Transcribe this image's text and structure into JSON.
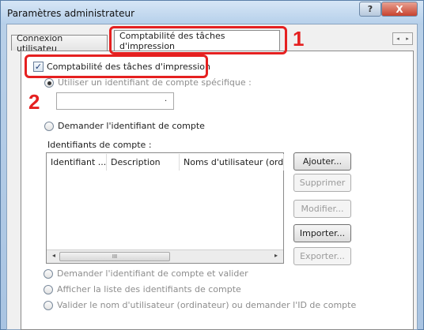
{
  "window": {
    "title": "Paramètres administrateur",
    "help_label": "?",
    "close_label": "X"
  },
  "tabs": [
    {
      "label": "Connexion utilisateu"
    },
    {
      "label": "Comptabilité des tâches d'impression"
    }
  ],
  "tab_scroll": {
    "left": "◂",
    "right": "▸"
  },
  "callouts": {
    "one": "1",
    "two": "2"
  },
  "accounting_checkbox": {
    "label": "Comptabilité des tâches d'impression",
    "checked": true
  },
  "option_specific_id": {
    "label": "Utiliser un identifiant de compte spécifique :"
  },
  "account_id_field": {
    "value": "."
  },
  "option_ask_id": {
    "label": "Demander l'identifiant de compte"
  },
  "account_ids": {
    "label": "Identifiants de compte :",
    "columns": [
      "Identifiant ...",
      "Description",
      "Noms d'utilisateur (ordi"
    ]
  },
  "buttons": {
    "add": "Ajouter...",
    "delete": "Supprimer",
    "modify": "Modifier...",
    "import": "Importer...",
    "export": "Exporter..."
  },
  "scrollbar": {
    "left": "◂",
    "right": "▸",
    "thumb": "III"
  },
  "bottom_options": [
    {
      "label": "Demander l'identifiant de compte et valider"
    },
    {
      "label": "Afficher la liste des identifiants de compte"
    },
    {
      "label": "Valider le nom d'utilisateur (ordinateur) ou demander l'ID de compte"
    }
  ],
  "colors": {
    "highlight": "#e52020",
    "title_bar": "#b5cfea"
  }
}
